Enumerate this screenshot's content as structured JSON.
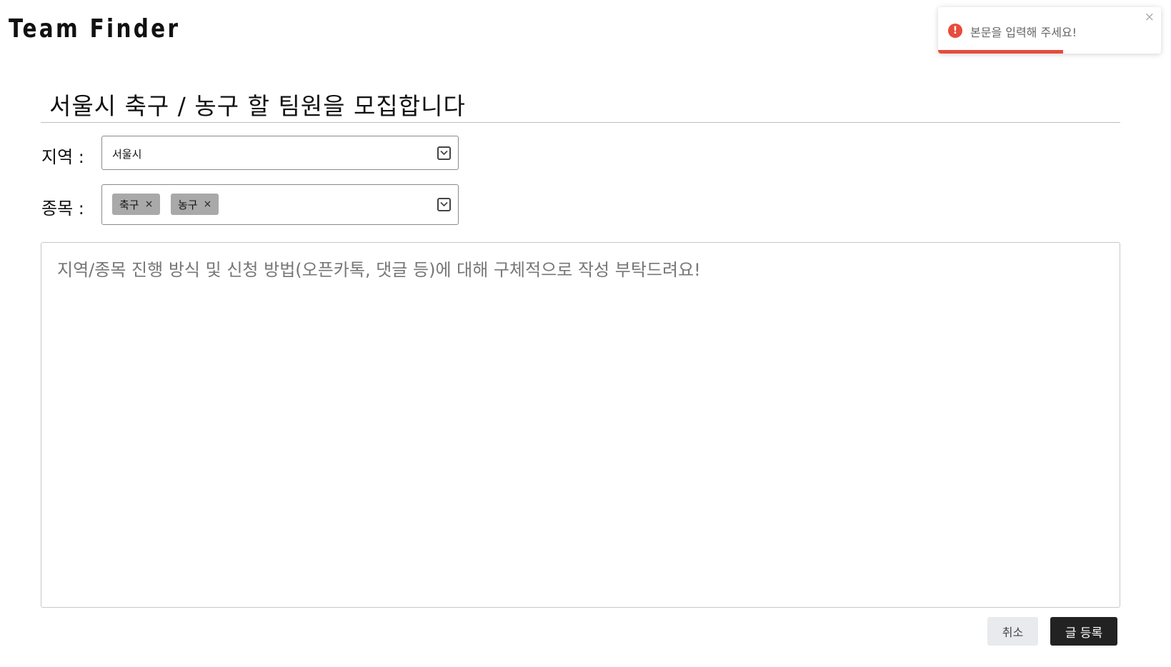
{
  "header": {
    "logo": "Team Finder"
  },
  "post": {
    "title": "서울시 축구 / 농구 할 팀원을 모집합니다"
  },
  "region": {
    "label": "지역 :",
    "selected": "서울시",
    "chevron_icon": "chevron-down-icon"
  },
  "sport": {
    "label": "종목 :",
    "chips": [
      {
        "label": "축구",
        "remove": "×"
      },
      {
        "label": "농구",
        "remove": "×"
      }
    ],
    "chevron_icon": "chevron-down-icon"
  },
  "content": {
    "placeholder": "지역/종목 진행 방식 및 신청 방법(오픈카톡, 댓글 등)에 대해 구체적으로 작성 부탁드려요!"
  },
  "actions": {
    "cancel_label": "취소",
    "submit_label": "글 등록"
  },
  "toast": {
    "icon": "error-icon",
    "icon_glyph": "!",
    "message": "본문을 입력해 주세요!",
    "close": "×",
    "progress": 0.56,
    "color": "#e74c3c"
  }
}
